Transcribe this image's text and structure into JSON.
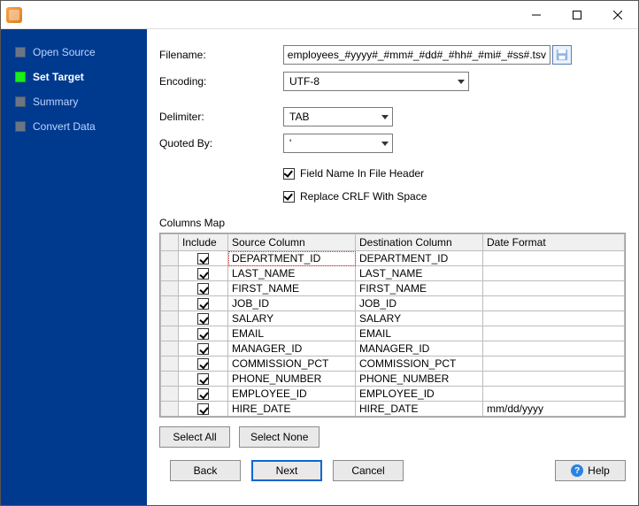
{
  "sidebar": {
    "items": [
      {
        "label": "Open Source",
        "active": false
      },
      {
        "label": "Set Target",
        "active": true
      },
      {
        "label": "Summary",
        "active": false
      },
      {
        "label": "Convert Data",
        "active": false
      }
    ]
  },
  "form": {
    "filename_label": "Filename:",
    "filename_value": "ts\\employees_#yyyy#_#mm#_#dd#_#hh#_#mi#_#ss#.tsv",
    "encoding_label": "Encoding:",
    "encoding_value": "UTF-8",
    "delimiter_label": "Delimiter:",
    "delimiter_value": "TAB",
    "quoted_label": "Quoted By:",
    "quoted_value": "'",
    "field_name_header_label": "Field Name In File Header",
    "replace_crlf_label": "Replace CRLF With Space"
  },
  "columns_map": {
    "title": "Columns Map",
    "headers": {
      "include": "Include",
      "source": "Source Column",
      "destination": "Destination Column",
      "date_format": "Date Format"
    },
    "rows": [
      {
        "include": true,
        "source": "DEPARTMENT_ID",
        "destination": "DEPARTMENT_ID",
        "date_format": ""
      },
      {
        "include": true,
        "source": "LAST_NAME",
        "destination": "LAST_NAME",
        "date_format": ""
      },
      {
        "include": true,
        "source": "FIRST_NAME",
        "destination": "FIRST_NAME",
        "date_format": ""
      },
      {
        "include": true,
        "source": "JOB_ID",
        "destination": "JOB_ID",
        "date_format": ""
      },
      {
        "include": true,
        "source": "SALARY",
        "destination": "SALARY",
        "date_format": ""
      },
      {
        "include": true,
        "source": "EMAIL",
        "destination": "EMAIL",
        "date_format": ""
      },
      {
        "include": true,
        "source": "MANAGER_ID",
        "destination": "MANAGER_ID",
        "date_format": ""
      },
      {
        "include": true,
        "source": "COMMISSION_PCT",
        "destination": "COMMISSION_PCT",
        "date_format": ""
      },
      {
        "include": true,
        "source": "PHONE_NUMBER",
        "destination": "PHONE_NUMBER",
        "date_format": ""
      },
      {
        "include": true,
        "source": "EMPLOYEE_ID",
        "destination": "EMPLOYEE_ID",
        "date_format": ""
      },
      {
        "include": true,
        "source": "HIRE_DATE",
        "destination": "HIRE_DATE",
        "date_format": "mm/dd/yyyy"
      }
    ]
  },
  "buttons": {
    "select_all": "Select All",
    "select_none": "Select None",
    "back": "Back",
    "next": "Next",
    "cancel": "Cancel",
    "help": "Help"
  }
}
